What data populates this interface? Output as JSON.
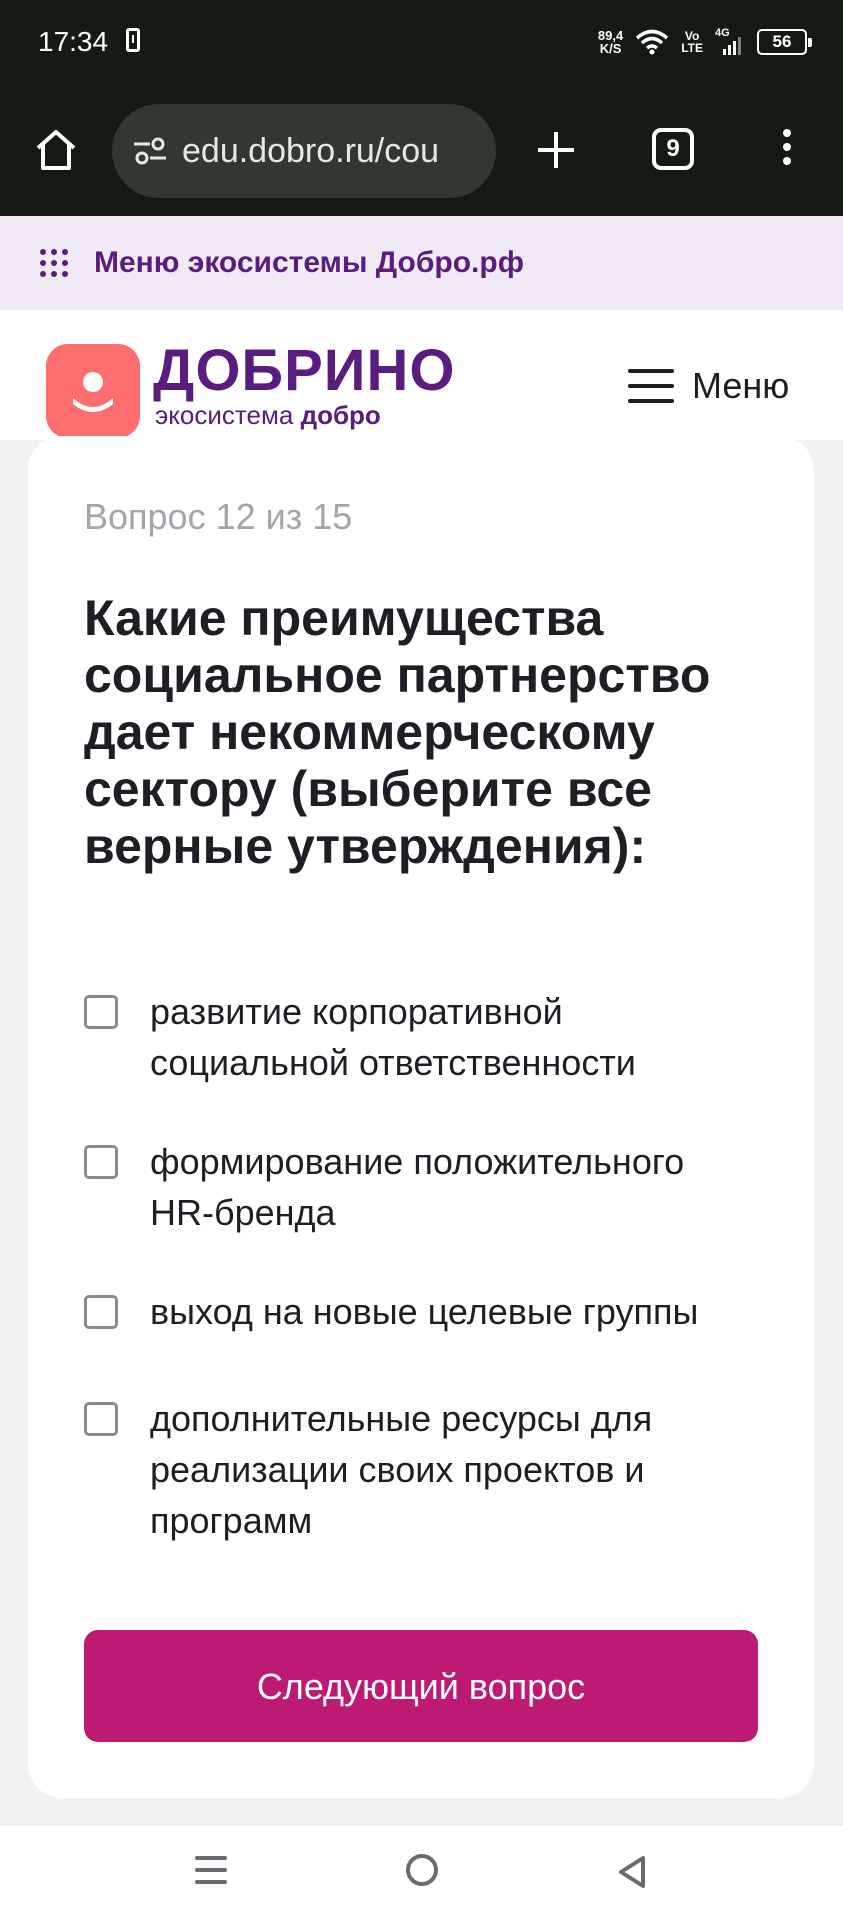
{
  "status_bar": {
    "time": "17:34",
    "net_speed_value": "89,4",
    "net_speed_unit": "K/S",
    "volte_top": "Vo",
    "volte_bottom": "LTE",
    "network": "4G",
    "battery": "56"
  },
  "browser": {
    "url": "edu.dobro.ru/cou",
    "tab_count": "9",
    "icons": [
      "home-icon",
      "tune-icon",
      "plus-icon",
      "tabs-icon",
      "more-vert-icon"
    ]
  },
  "eco_menu": {
    "label": "Меню экосистемы Добро.рф"
  },
  "header": {
    "logo_title": "ДОБРИНО",
    "logo_sub_prefix": "экосистема ",
    "logo_sub_brand": "добро",
    "menu_label": "Меню"
  },
  "quiz": {
    "counter": "Вопрос 12 из 15",
    "question": "Какие преимущества социальное партнерство дает некоммерческому сектору (выберите все верные утверждения):",
    "options": [
      {
        "label": "развитие корпоративной социальной ответственности",
        "checked": false
      },
      {
        "label": "формирование положительного HR-бренда",
        "checked": false
      },
      {
        "label": "выход на новые целевые группы",
        "checked": false
      },
      {
        "label": "дополнительные ресурсы для реализации своих проектов и программ",
        "checked": false
      }
    ],
    "next_button": "Следующий вопрос"
  },
  "colors": {
    "brand_purple": "#5a1c7e",
    "logo_coral": "#ff6e6e",
    "button_magenta": "#bc1a73",
    "eco_bar_bg": "#efeaf3"
  }
}
